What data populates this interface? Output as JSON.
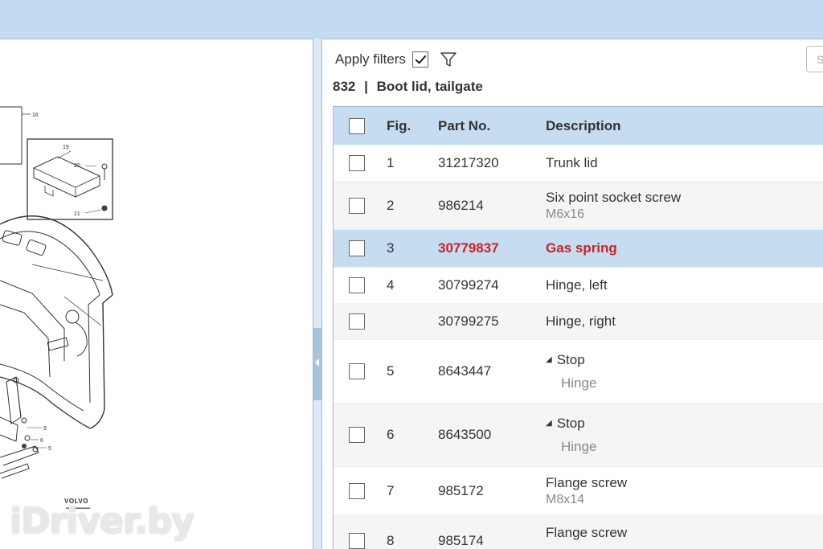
{
  "filters": {
    "apply_label": "Apply filters",
    "apply_checked": true,
    "search_placeholder": "S"
  },
  "section": {
    "number": "832",
    "separator": "|",
    "title": "Boot lid, tailgate"
  },
  "table": {
    "headers": {
      "fig": "Fig.",
      "part": "Part No.",
      "desc": "Description"
    },
    "rows": [
      {
        "fig": "1",
        "part": "31217320",
        "desc": "Trunk lid",
        "sub": ""
      },
      {
        "fig": "2",
        "part": "986214",
        "desc": "Six point socket screw",
        "sub": "M6x16"
      },
      {
        "fig": "3",
        "part": "30779837",
        "desc": "Gas spring",
        "sub": "",
        "selected": true
      },
      {
        "fig": "4",
        "part": "30799274",
        "desc": "Hinge, left",
        "sub": ""
      },
      {
        "fig": "",
        "part": "30799275",
        "desc": "Hinge, right",
        "sub": ""
      },
      {
        "fig": "5",
        "part": "8643447",
        "desc": "Stop",
        "child": "Hinge"
      },
      {
        "fig": "6",
        "part": "8643500",
        "desc": "Stop",
        "child": "Hinge"
      },
      {
        "fig": "7",
        "part": "985172",
        "desc": "Flange screw",
        "sub": "M8x14"
      },
      {
        "fig": "8",
        "part": "985174",
        "desc": "Flange screw",
        "sub": ""
      }
    ]
  },
  "diagram": {
    "callouts": [
      "16",
      "19",
      "20",
      "21",
      "9",
      "6",
      "5"
    ],
    "brand": "VOLVO",
    "watermark": "iDriver.by"
  },
  "colors": {
    "accent": "#c3daf1",
    "selected_text": "#cc2222"
  }
}
